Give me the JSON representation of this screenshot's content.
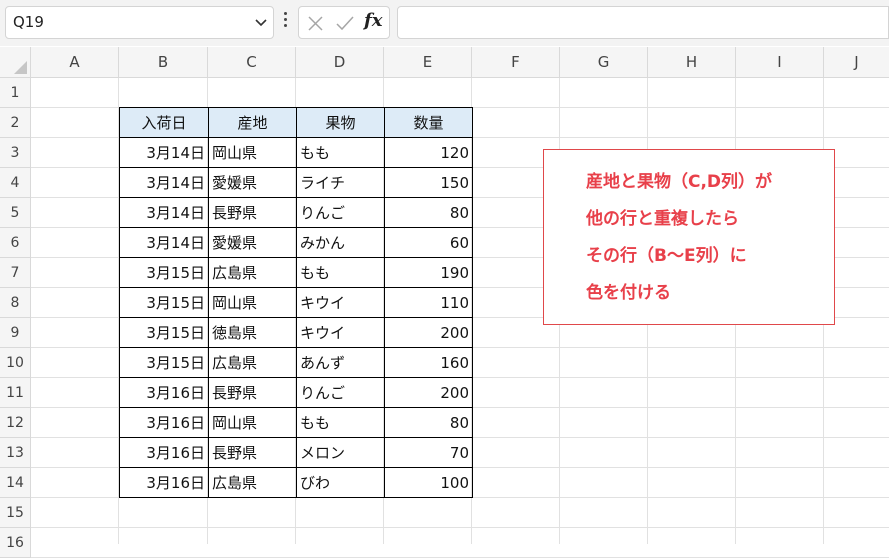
{
  "name_box": {
    "value": "Q19"
  },
  "formula_bar": {
    "fx_label": "fx",
    "value": ""
  },
  "columns": [
    "A",
    "B",
    "C",
    "D",
    "E",
    "F",
    "G",
    "H",
    "I",
    "J"
  ],
  "rows": [
    "1",
    "2",
    "3",
    "4",
    "5",
    "6",
    "7",
    "8",
    "9",
    "10",
    "11",
    "12",
    "13",
    "14",
    "15",
    "16"
  ],
  "table": {
    "headers": [
      "入荷日",
      "産地",
      "果物",
      "数量"
    ],
    "rows": [
      [
        "3月14日",
        "岡山県",
        "もも",
        "120"
      ],
      [
        "3月14日",
        "愛媛県",
        "ライチ",
        "150"
      ],
      [
        "3月14日",
        "長野県",
        "りんご",
        "80"
      ],
      [
        "3月14日",
        "愛媛県",
        "みかん",
        "60"
      ],
      [
        "3月15日",
        "広島県",
        "もも",
        "190"
      ],
      [
        "3月15日",
        "岡山県",
        "キウイ",
        "110"
      ],
      [
        "3月15日",
        "徳島県",
        "キウイ",
        "200"
      ],
      [
        "3月15日",
        "広島県",
        "あんず",
        "160"
      ],
      [
        "3月16日",
        "長野県",
        "りんご",
        "200"
      ],
      [
        "3月16日",
        "岡山県",
        "もも",
        "80"
      ],
      [
        "3月16日",
        "長野県",
        "メロン",
        "70"
      ],
      [
        "3月16日",
        "広島県",
        "びわ",
        "100"
      ]
    ]
  },
  "note": {
    "lines": [
      "産地と果物（C,D列）が",
      "他の行と重複したら",
      "その行（B〜E列）に",
      "色を付ける"
    ],
    "color": "#e8404a"
  },
  "colors": {
    "header_fill": "#ddebf7",
    "note_border": "#e0484a"
  }
}
